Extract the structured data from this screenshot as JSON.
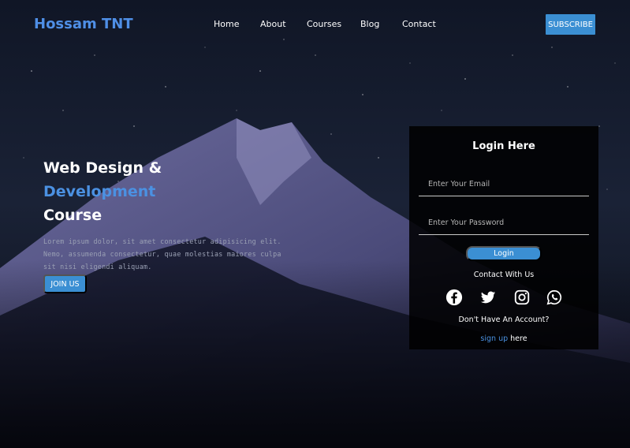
{
  "header": {
    "logo": "Hossam TNT",
    "nav": [
      "Home",
      "About",
      "Courses",
      "Blog",
      "Contact"
    ],
    "subscribe": "SUBSCRIBE"
  },
  "hero": {
    "title_line1": "Web Design &",
    "title_line2": "Development",
    "title_line3": "Course",
    "description": "Lorem ipsum dolor, sit amet consectetur adipisicing elit. Nemo, assumenda consectetur, quae molestias maiores culpa sit nisi eligendi aliquam.",
    "join_button": "JOIN US"
  },
  "login": {
    "title": "Login Here",
    "email_placeholder": "Enter Your Email",
    "password_placeholder": "Enter Your Password",
    "login_button": "Login",
    "contact_label": "Contact With Us",
    "socials": [
      "facebook-icon",
      "twitter-icon",
      "instagram-icon",
      "whatsapp-icon"
    ],
    "no_account": "Don't Have An Account?",
    "signup_link": "sign up",
    "signup_suffix": " here"
  },
  "colors": {
    "accent": "#3b8fd3",
    "logo": "#4f8fe6",
    "background": "#05060c"
  }
}
